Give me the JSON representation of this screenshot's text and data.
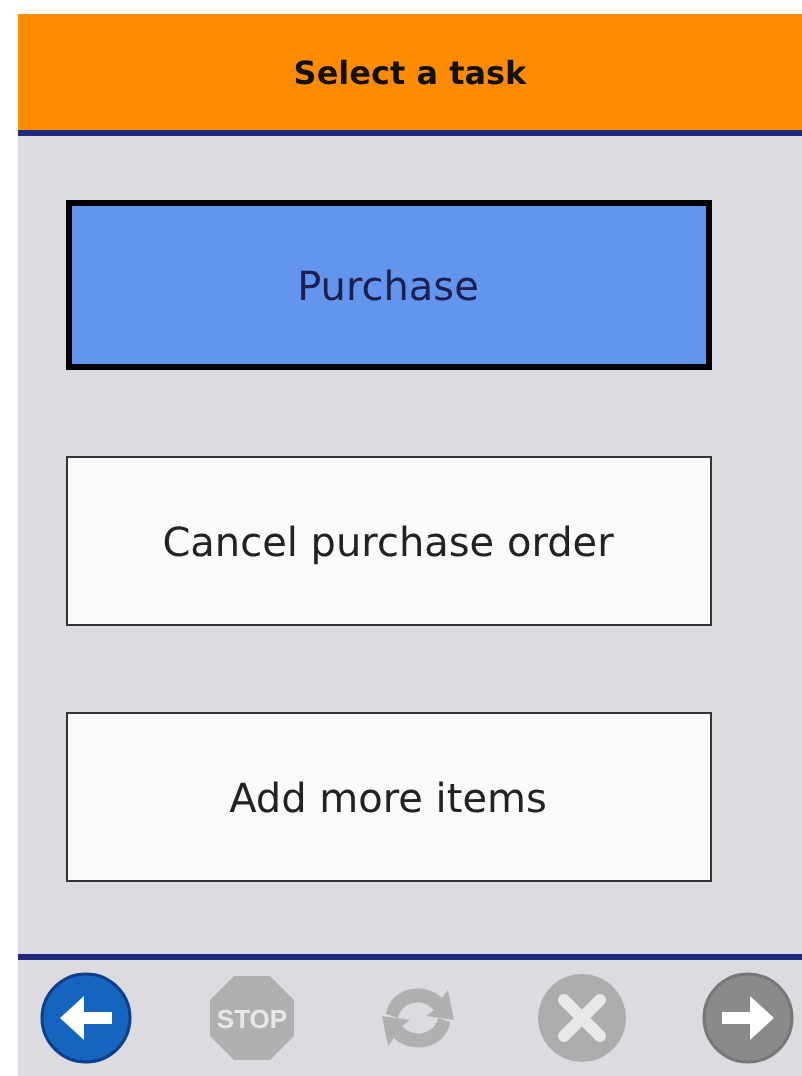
{
  "header": {
    "title": "Select a task"
  },
  "tasks": [
    {
      "label": "Purchase",
      "selected": true
    },
    {
      "label": "Cancel purchase order",
      "selected": false
    },
    {
      "label": "Add more items",
      "selected": false
    }
  ],
  "toolbar": [
    {
      "kind": "back",
      "disabled": false
    },
    {
      "kind": "stop",
      "label": "STOP",
      "disabled": true
    },
    {
      "kind": "refresh",
      "disabled": true
    },
    {
      "kind": "cancel",
      "disabled": true
    },
    {
      "kind": "forward",
      "disabled": true
    }
  ]
}
